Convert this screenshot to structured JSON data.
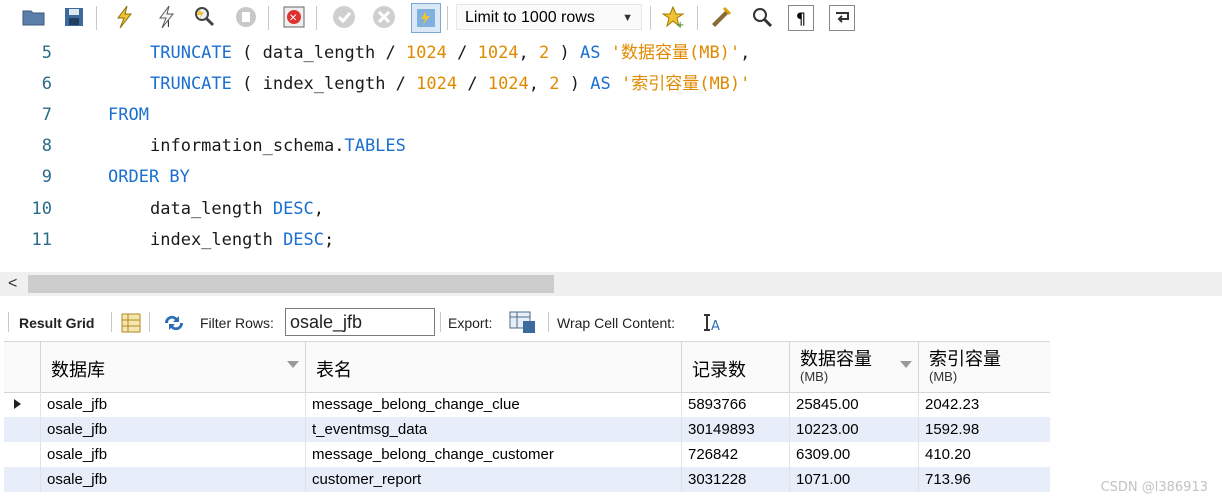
{
  "toolbar": {
    "limit_label": "Limit to 1000 rows",
    "icons": [
      "folder-icon",
      "save-icon",
      "execute-icon",
      "execute-current-icon",
      "explain-icon",
      "stop-icon",
      "toggle-error-icon",
      "commit-icon",
      "rollback-icon",
      "autocommit-icon",
      "favorite-icon",
      "beautify-icon",
      "find-icon",
      "invisible-chars-icon",
      "wrap-icon"
    ]
  },
  "editor": {
    "lines": [
      {
        "num": "5",
        "parts": [
          {
            "t": "TRUNCATE",
            "c": "kw"
          },
          {
            "t": " ( ",
            "c": "id"
          },
          {
            "t": "data_length",
            "c": "id"
          },
          {
            "t": " / ",
            "c": "id"
          },
          {
            "t": "1024",
            "c": "num"
          },
          {
            "t": " / ",
            "c": "id"
          },
          {
            "t": "1024",
            "c": "num"
          },
          {
            "t": ", ",
            "c": "id"
          },
          {
            "t": "2",
            "c": "num"
          },
          {
            "t": " ) ",
            "c": "id"
          },
          {
            "t": "AS",
            "c": "kw"
          },
          {
            "t": " ",
            "c": "id"
          },
          {
            "t": "'数据容量(MB)'",
            "c": "str"
          },
          {
            "t": ",",
            "c": "id"
          }
        ],
        "indent": 150
      },
      {
        "num": "6",
        "parts": [
          {
            "t": "TRUNCATE",
            "c": "kw"
          },
          {
            "t": " ( ",
            "c": "id"
          },
          {
            "t": "index_length",
            "c": "id"
          },
          {
            "t": " / ",
            "c": "id"
          },
          {
            "t": "1024",
            "c": "num"
          },
          {
            "t": " / ",
            "c": "id"
          },
          {
            "t": "1024",
            "c": "num"
          },
          {
            "t": ", ",
            "c": "id"
          },
          {
            "t": "2",
            "c": "num"
          },
          {
            "t": " ) ",
            "c": "id"
          },
          {
            "t": "AS",
            "c": "kw"
          },
          {
            "t": " ",
            "c": "id"
          },
          {
            "t": "'索引容量(MB)'",
            "c": "str"
          }
        ],
        "indent": 150
      },
      {
        "num": "7",
        "parts": [
          {
            "t": "FROM",
            "c": "kw"
          }
        ],
        "indent": 108
      },
      {
        "num": "8",
        "parts": [
          {
            "t": "information_schema.",
            "c": "id"
          },
          {
            "t": "TABLES",
            "c": "kw"
          }
        ],
        "indent": 150
      },
      {
        "num": "9",
        "parts": [
          {
            "t": "ORDER BY",
            "c": "kw"
          }
        ],
        "indent": 108
      },
      {
        "num": "10",
        "parts": [
          {
            "t": "data_length ",
            "c": "id"
          },
          {
            "t": "DESC",
            "c": "kw"
          },
          {
            "t": ",",
            "c": "id"
          }
        ],
        "indent": 150
      },
      {
        "num": "11",
        "parts": [
          {
            "t": "index_length ",
            "c": "id"
          },
          {
            "t": "DESC",
            "c": "kw"
          },
          {
            "t": ";",
            "c": "id"
          }
        ],
        "indent": 150
      }
    ]
  },
  "result_toolbar": {
    "result_grid_label": "Result Grid",
    "filter_label": "Filter Rows:",
    "filter_value": "osale_jfb",
    "export_label": "Export:",
    "wrap_label": "Wrap Cell Content:"
  },
  "grid": {
    "columns": [
      {
        "label": "数据库",
        "sub": "",
        "dropdown": true
      },
      {
        "label": "表名",
        "sub": "",
        "dropdown": false
      },
      {
        "label": "记录数",
        "sub": "",
        "dropdown": false
      },
      {
        "label": "数据容量",
        "sub": "(MB)",
        "dropdown": true
      },
      {
        "label": "索引容量",
        "sub": "(MB)",
        "dropdown": false
      }
    ],
    "rows": [
      [
        "osale_jfb",
        "message_belong_change_clue",
        "5893766",
        "25845.00",
        "2042.23"
      ],
      [
        "osale_jfb",
        "t_eventmsg_data",
        "30149893",
        "10223.00",
        "1592.98"
      ],
      [
        "osale_jfb",
        "message_belong_change_customer",
        "726842",
        "6309.00",
        "410.20"
      ],
      [
        "osale_jfb",
        "customer_report",
        "3031228",
        "1071.00",
        "713.96"
      ]
    ]
  },
  "watermark": "CSDN @l386913"
}
